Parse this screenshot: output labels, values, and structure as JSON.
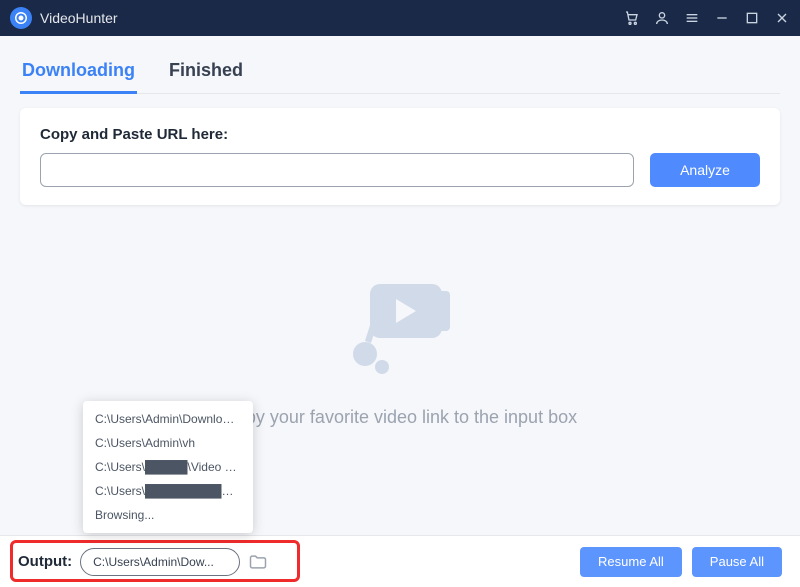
{
  "app": {
    "title": "VideoHunter"
  },
  "tabs": {
    "downloading": "Downloading",
    "finished": "Finished",
    "active": "downloading"
  },
  "urlCard": {
    "label": "Copy and Paste URL here:",
    "placeholder": "",
    "analyze": "Analyze"
  },
  "emptyState": {
    "message": "Copy your favorite video link to the input box"
  },
  "outputDropdown": {
    "items": [
      "C:\\Users\\Admin\\Downloads",
      "C:\\Users\\Admin\\vh",
      "C:\\Users\\█████\\Video Hun...",
      "C:\\Users\\██████████\\Do...",
      "Browsing..."
    ]
  },
  "footer": {
    "outputLabel": "Output:",
    "outputValue": "C:\\Users\\Admin\\Dow...",
    "resumeAll": "Resume All",
    "pauseAll": "Pause All"
  },
  "icons": {
    "cart": "cart-icon",
    "user": "user-icon",
    "menu": "menu-icon",
    "minimize": "minimize-icon",
    "maximize": "maximize-icon",
    "close": "close-icon",
    "folder": "folder-icon",
    "logo": "app-logo-icon"
  }
}
